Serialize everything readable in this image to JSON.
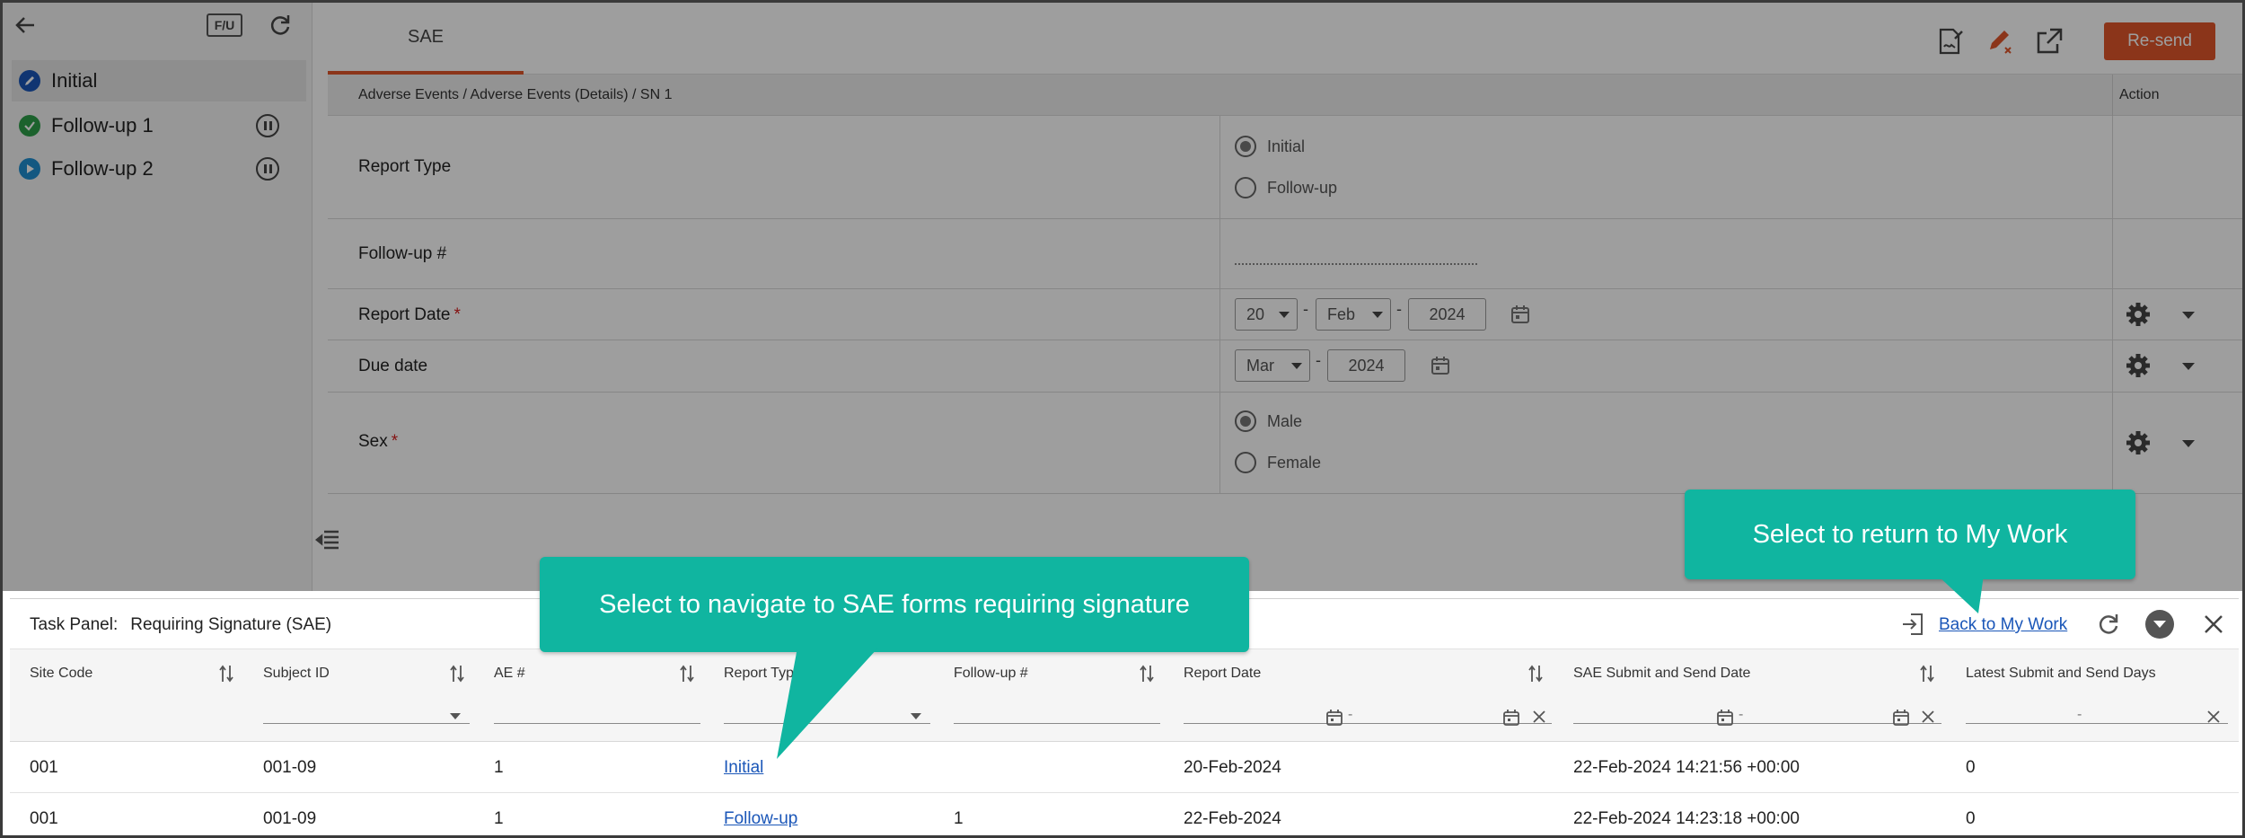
{
  "sidebar": {
    "fu_label": "F/U",
    "items": [
      {
        "label": "Initial",
        "status_color": "#1a56b8"
      },
      {
        "label": "Follow-up 1",
        "status_color": "#2e9e4a"
      },
      {
        "label": "Follow-up 2",
        "status_color": "#1f8fd0"
      }
    ]
  },
  "header": {
    "tab": "SAE",
    "resend_label": "Re-send",
    "accent": "#e0562a"
  },
  "form": {
    "breadcrumb": "Adverse Events / Adverse Events (Details) / SN 1",
    "action_header": "Action",
    "fields": {
      "report_type": {
        "label": "Report Type",
        "options": [
          "Initial",
          "Follow-up"
        ],
        "selected": "Initial"
      },
      "followup_no": {
        "label": "Follow-up #",
        "value": ""
      },
      "report_date": {
        "label": "Report Date",
        "required": "*",
        "day": "20",
        "month": "Feb",
        "year": "2024"
      },
      "due_date": {
        "label": "Due date",
        "month": "Mar",
        "year": "2024"
      },
      "sex": {
        "label": "Sex",
        "required": "*",
        "options": [
          "Male",
          "Female"
        ],
        "selected": "Male"
      }
    },
    "date_separator": "-"
  },
  "task_panel": {
    "label": "Task Panel:",
    "title": "Requiring Signature (SAE)",
    "back_link": "Back to My Work",
    "columns": [
      "Site Code",
      "Subject ID",
      "AE #",
      "Report Type",
      "Follow-up #",
      "Report Date",
      "SAE Submit and Send Date",
      "Latest Submit and Send Days"
    ],
    "filter_dash": "-",
    "rows": [
      [
        "001",
        "001-09",
        "1",
        "Initial",
        "",
        "20-Feb-2024",
        "22-Feb-2024 14:21:56 +00:00",
        "0"
      ],
      [
        "001",
        "001-09",
        "1",
        "Follow-up",
        "1",
        "22-Feb-2024",
        "22-Feb-2024 14:23:18 +00:00",
        "0"
      ]
    ]
  },
  "callouts": {
    "forms": "Select to navigate to SAE forms requiring signature",
    "mywork": "Select to return to My Work",
    "color": "#10b5a0"
  }
}
